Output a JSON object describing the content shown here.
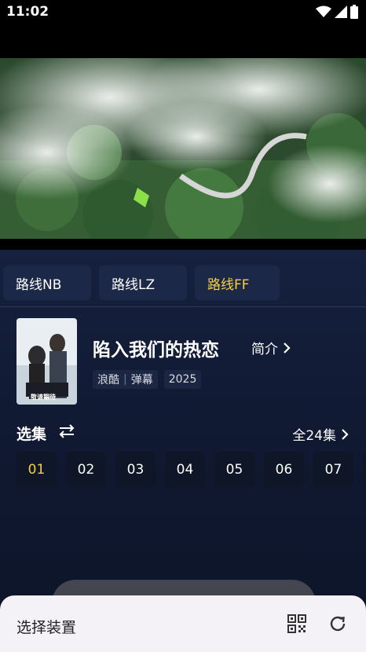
{
  "status_bar": {
    "time": "11:02"
  },
  "route_tabs": [
    {
      "label": "路线NB",
      "active": false
    },
    {
      "label": "路线LZ",
      "active": false
    },
    {
      "label": "路线FF",
      "active": true
    }
  ],
  "show": {
    "title": "陷入我们的热恋",
    "intro_label": "简介",
    "tags": {
      "source": "浪酷",
      "danmaku": "弹幕",
      "year": "2025"
    },
    "poster_text": "敬请期待"
  },
  "episodes": {
    "select_label": "选集",
    "total_label": "全24集",
    "items": [
      "01",
      "02",
      "03",
      "04",
      "05",
      "06",
      "07"
    ],
    "active_index": 0
  },
  "bottom_sheet": {
    "title": "选择装置"
  },
  "colors": {
    "accent": "#f5d23c",
    "background": "#111a33",
    "sheet": "#f4f1f7"
  }
}
